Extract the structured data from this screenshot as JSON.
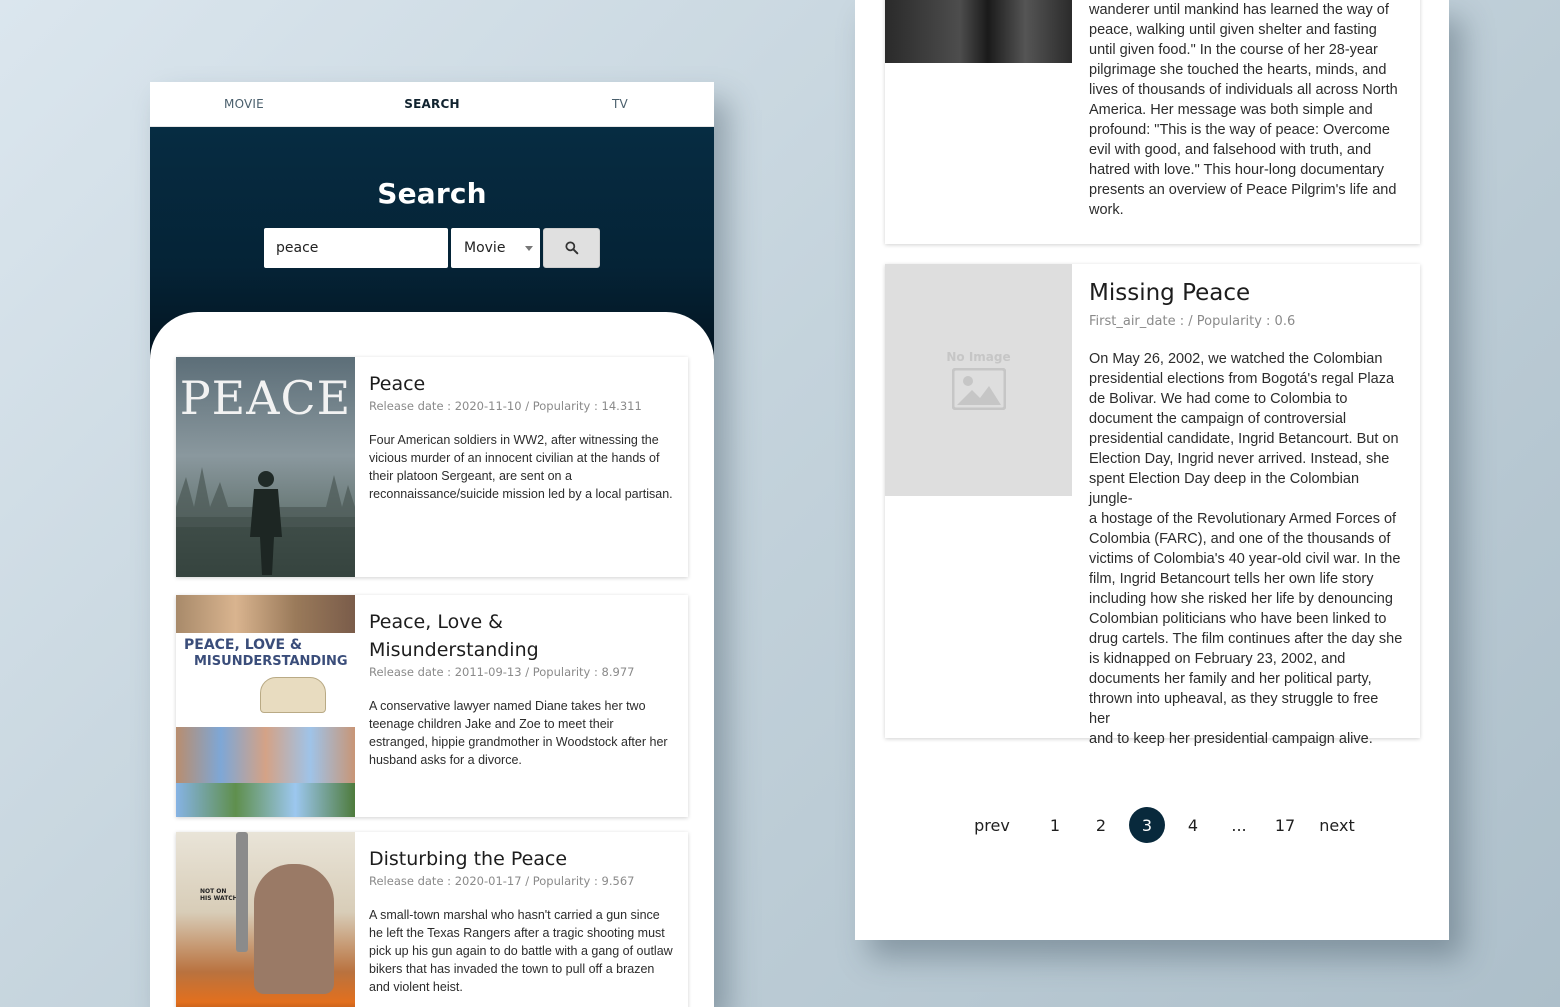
{
  "tabs": [
    {
      "label": "MOVIE"
    },
    {
      "label": "SEARCH"
    },
    {
      "label": "TV"
    }
  ],
  "hero": {
    "title": "Search",
    "search_value": "peace",
    "type_selected": "Movie"
  },
  "results": [
    {
      "title": "Peace",
      "meta": "Release date : 2020-11-10 / Popularity : 14.311",
      "overview": "Four American soldiers in WW2, after witnessing the vicious murder of an innocent civilian at the hands of their platoon Sergeant, are sent on a reconnaissance/suicide mission led by a local partisan.",
      "poster_text": "PEACE"
    },
    {
      "title": "Peace, Love & Misunderstanding",
      "meta": "Release date : 2011-09-13 / Popularity : 8.977",
      "overview": "A conservative lawyer named Diane takes her two teenage children Jake and Zoe to meet their estranged, hippie grandmother in Woodstock after her husband asks for a divorce.",
      "poster_text_1": "PEACE, LOVE &",
      "poster_text_2": "MISUNDERSTANDING"
    },
    {
      "title": "Disturbing the Peace",
      "meta": "Release date : 2020-01-17 / Popularity : 9.567",
      "overview": "A small-town marshal who hasn't carried a gun since he left the Texas Rangers after a tragic shooting must pick up his gun again to do battle with a gang of outlaw bikers that has invaded the town to pull off a brazen and violent heist.",
      "poster_text": "NOT ON HIS WATCH"
    }
  ],
  "right": {
    "card1_desc_lines": [
      "wanderer until mankind has learned the way of",
      "peace, walking until given shelter and fasting",
      "until given food.\" In the course of her 28-year",
      "pilgrimage she touched the hearts, minds, and",
      "lives of thousands of individuals all across North",
      "America. Her message was both simple and",
      "profound: \"This is the way of peace: Overcome",
      "evil with good, and falsehood with truth, and",
      "hatred with love.\" This hour-long documentary",
      "presents an overview of Peace Pilgrim's life and",
      "work."
    ],
    "card2": {
      "title": "Missing Peace",
      "meta": "First_air_date : / Popularity : 0.6",
      "no_image": "No Image",
      "desc_lines": [
        "On May 26, 2002, we watched the Colombian",
        "presidential elections from Bogotá's regal Plaza",
        "de Bolivar. We had come to Colombia to",
        "document the campaign of controversial",
        "presidential candidate, Ingrid Betancourt. But on",
        "Election Day, Ingrid never arrived. Instead, she",
        "spent Election Day deep in the Colombian jungle-",
        "a hostage of the Revolutionary Armed Forces of",
        "Colombia (FARC), and one of the thousands of",
        "victims of Colombia's 40 year-old civil war. In the",
        "film, Ingrid Betancourt tells her own life story",
        "including how she risked her life by denouncing",
        "Colombian politicians who have been linked to",
        "drug cartels. The film continues after the day she",
        "is kidnapped on February 23, 2002, and",
        "documents her family and her political party,",
        "thrown into upheaval, as they struggle to free her",
        "and to keep her presidential campaign alive."
      ]
    }
  },
  "pagination": {
    "prev": "prev",
    "pages": [
      "1",
      "2",
      "3",
      "4",
      "...",
      "17"
    ],
    "current": "3",
    "next": "next"
  },
  "colors": {
    "hero_dark": "#052336",
    "active_page": "#08293c"
  }
}
